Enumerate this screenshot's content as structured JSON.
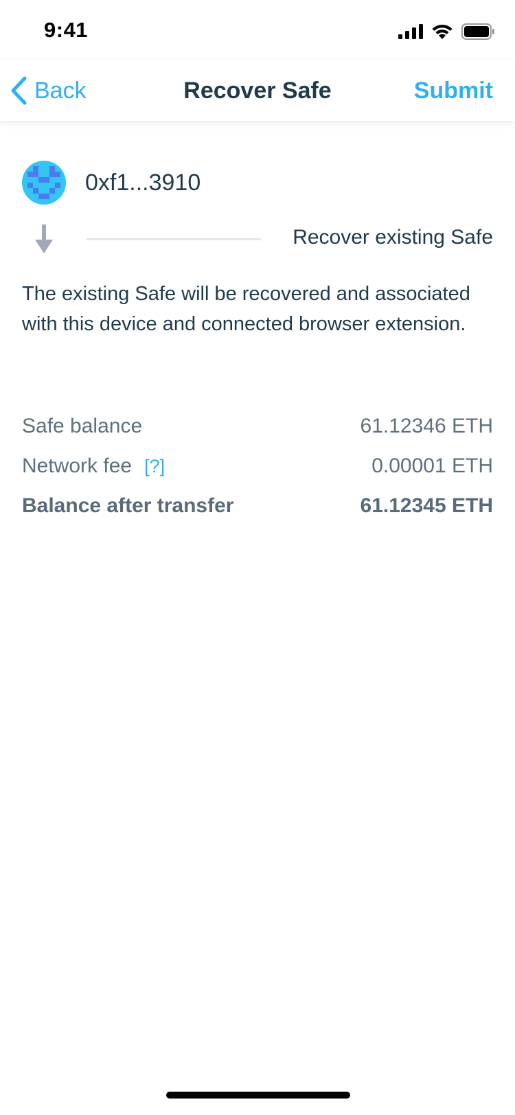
{
  "status_bar": {
    "time": "9:41"
  },
  "nav": {
    "back_label": "Back",
    "title": "Recover Safe",
    "submit_label": "Submit"
  },
  "safe": {
    "address": "0xf1...3910",
    "action_label": "Recover existing Safe"
  },
  "description": "The existing Safe will be recovered and associated with this device and connected browser extension.",
  "balances": {
    "safe_balance_label": "Safe balance",
    "safe_balance_value": "61.12346 ETH",
    "network_fee_label": "Network fee",
    "network_fee_help": "[?]",
    "network_fee_value": "0.00001 ETH",
    "after_transfer_label": "Balance after transfer",
    "after_transfer_value": "61.12345 ETH"
  },
  "colors": {
    "accent": "#2fb0f0",
    "text_primary": "#1f3a4d",
    "text_secondary": "#5e6f80",
    "arrow": "#a2a8ba",
    "divider": "#e3e6ea"
  },
  "icons": {
    "back": "chevron-left-icon",
    "arrow": "arrow-down-icon",
    "signal": "cellular-signal-icon",
    "wifi": "wifi-icon",
    "battery": "battery-icon"
  }
}
